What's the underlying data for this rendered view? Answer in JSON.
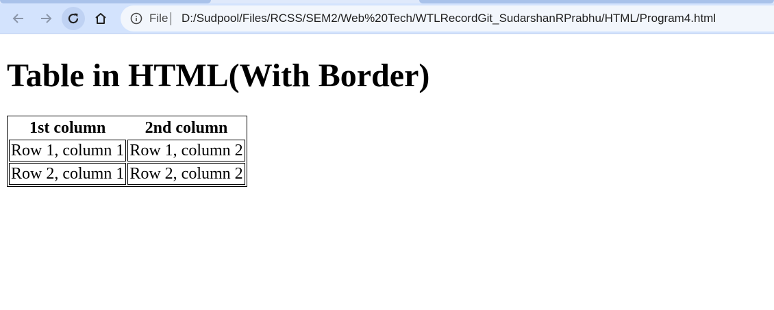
{
  "browser": {
    "nav": {
      "back_icon": "arrow-left-icon",
      "forward_icon": "arrow-right-icon",
      "reload_icon": "reload-icon",
      "home_icon": "home-icon"
    },
    "omnibox": {
      "info_icon": "info-circle-icon",
      "scheme_label": "File",
      "url": "D:/Sudpool/Files/RCSS/SEM2/Web%20Tech/WTLRecordGit_SudarshanRPrabhu/HTML/Program4.html"
    },
    "colors": {
      "toolbar_bg": "#d3e3fd",
      "omnibox_bg": "#f2f6fc"
    }
  },
  "page": {
    "title": "Table in HTML(With Border)",
    "table": {
      "headers": [
        "1st column",
        "2nd column"
      ],
      "rows": [
        [
          "Row 1, column 1",
          "Row 1, column 2"
        ],
        [
          "Row 2, column 1",
          "Row 2, column 2"
        ]
      ]
    }
  }
}
